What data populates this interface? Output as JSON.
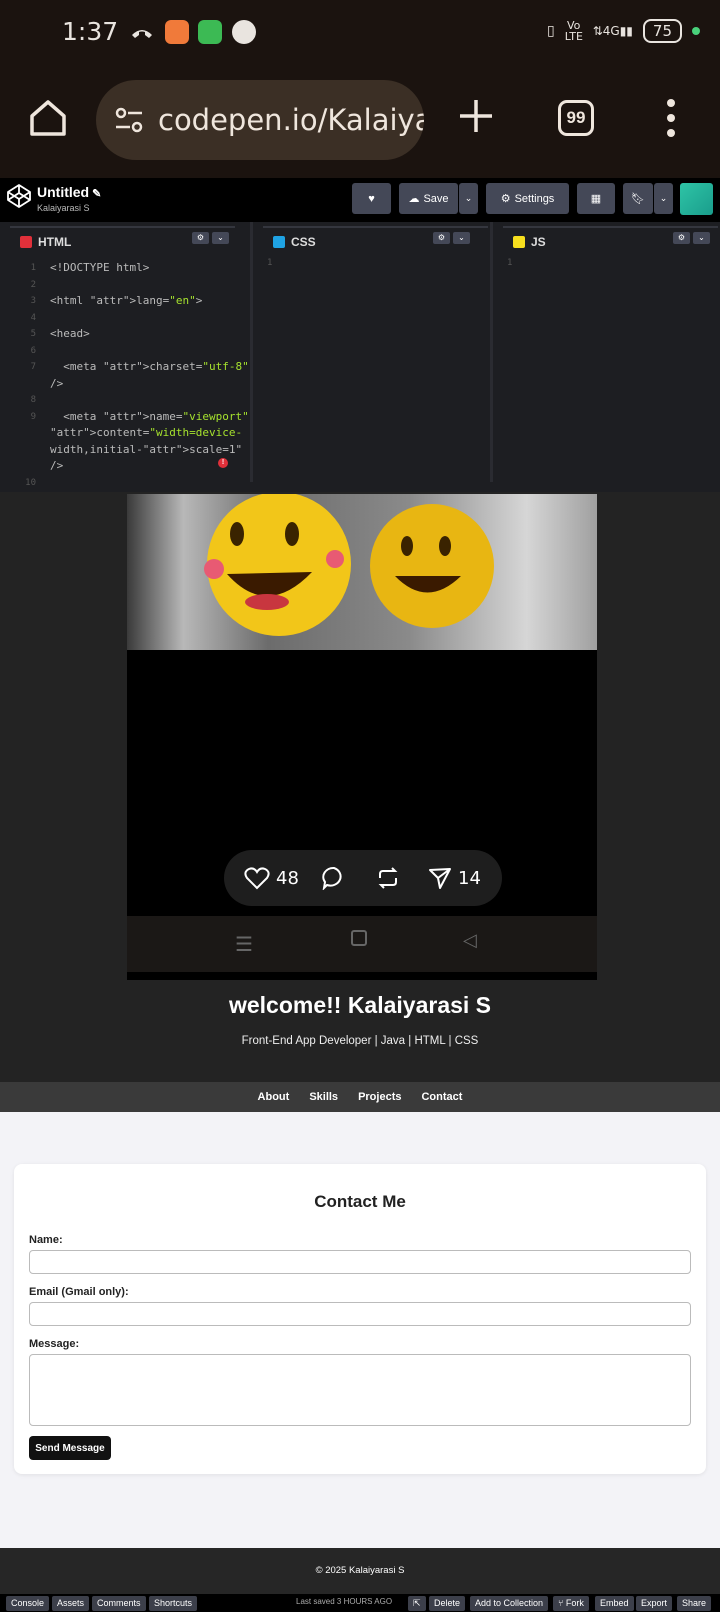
{
  "status_bar": {
    "time": "1:37",
    "network": "Vo LTE",
    "network2": "4G",
    "battery": "75"
  },
  "browser": {
    "url": "codepen.io/Kalaiya",
    "tab_count": "99"
  },
  "codepen": {
    "title": "Untitled",
    "author": "Kalaiyarasi S",
    "save_label": "Save",
    "settings_label": "Settings"
  },
  "editors": {
    "html_label": "HTML",
    "css_label": "CSS",
    "js_label": "JS",
    "html_lines": [
      {
        "n": "1",
        "text": "<!DOCTYPE html>"
      },
      {
        "n": "2",
        "text": ""
      },
      {
        "n": "3",
        "text": "<html lang=\"en\">"
      },
      {
        "n": "4",
        "text": ""
      },
      {
        "n": "5",
        "text": "<head>"
      },
      {
        "n": "6",
        "text": ""
      },
      {
        "n": "7",
        "text": "  <meta charset=\"utf-8\""
      },
      {
        "n": "",
        "text": "/>"
      },
      {
        "n": "8",
        "text": ""
      },
      {
        "n": "9",
        "text": "  <meta name=\"viewport\""
      },
      {
        "n": "",
        "text": "content=\"width=device-"
      },
      {
        "n": "",
        "text": "width,initial-scale=1\""
      },
      {
        "n": "",
        "text": "/>"
      },
      {
        "n": "10",
        "text": ""
      }
    ],
    "css_line": "1",
    "js_line": "1"
  },
  "preview": {
    "likes": "48",
    "shares": "14",
    "welcome": "welcome!! Kalaiyarasi S",
    "subtitle": "Front-End App Developer | Java | HTML | CSS",
    "nav": [
      "About",
      "Skills",
      "Projects",
      "Contact"
    ],
    "contact": {
      "heading": "Contact Me",
      "name_label": "Name:",
      "email_label": "Email (Gmail only):",
      "message_label": "Message:",
      "send_label": "Send Message"
    },
    "footer": "© 2025 Kalaiyarasi S"
  },
  "bottom_bar": {
    "console": "Console",
    "assets": "Assets",
    "comments": "Comments",
    "shortcuts": "Shortcuts",
    "last_saved": "Last saved 3 HOURS AGO",
    "delete": "Delete",
    "add_to_collection": "Add to Collection",
    "fork": "Fork",
    "embed": "Embed",
    "export": "Export",
    "share": "Share"
  }
}
